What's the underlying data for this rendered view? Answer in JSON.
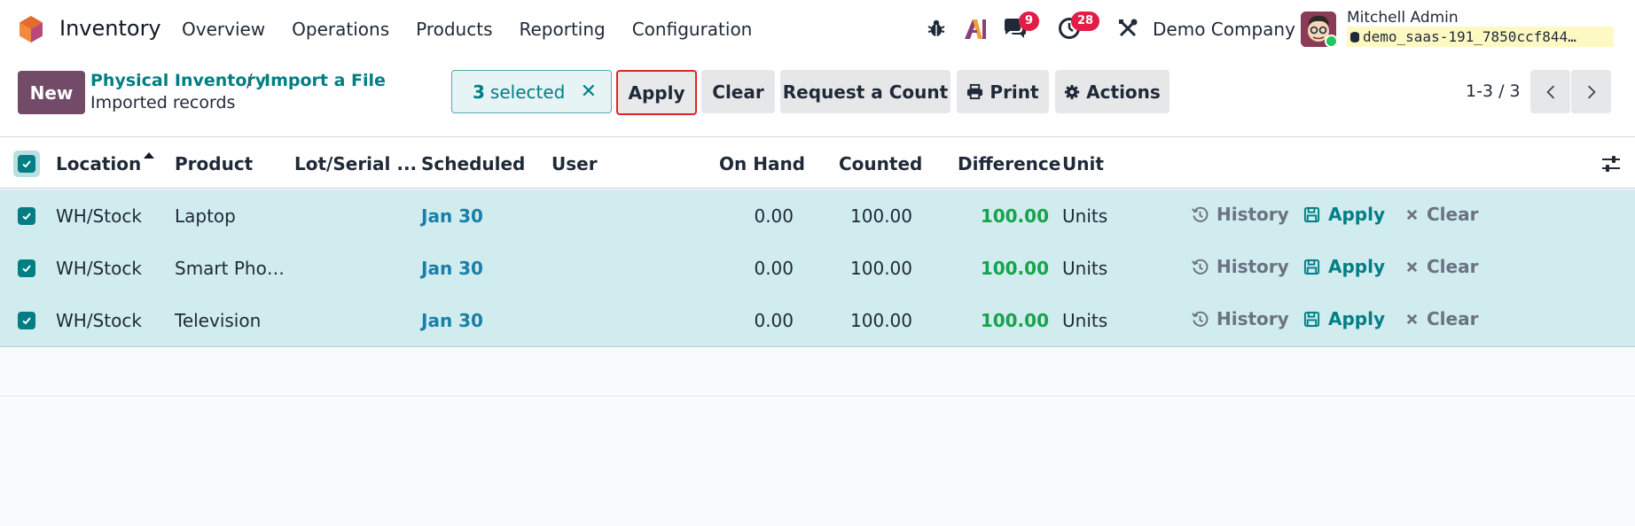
{
  "navbar": {
    "app_name": "Inventory",
    "menu": [
      "Overview",
      "Operations",
      "Products",
      "Reporting",
      "Configuration"
    ],
    "messages_badge": "9",
    "activities_badge": "28",
    "company": "Demo Company",
    "user_name": "Mitchell Admin",
    "database": "demo_saas-191_7850ccf844…"
  },
  "control_panel": {
    "new_label": "New",
    "breadcrumbs": [
      "Physical Inventory",
      "Import a File"
    ],
    "breadcrumb_separator": "/",
    "subtitle": "Imported records",
    "selected_count": "3",
    "selected_label": "selected",
    "apply_label": "Apply",
    "clear_label": "Clear",
    "request_count_label": "Request a Count",
    "print_label": "Print",
    "actions_label": "Actions",
    "pager": "1-3 / 3"
  },
  "table": {
    "columns": [
      "Location",
      "Product",
      "Lot/Serial ...",
      "Scheduled",
      "User",
      "On Hand",
      "Counted",
      "Difference",
      "Unit"
    ],
    "rows": [
      {
        "location": "WH/Stock",
        "product": "Laptop",
        "lot": "",
        "scheduled": "Jan 30",
        "user": "",
        "on_hand": "0.00",
        "counted": "100.00",
        "difference": "100.00",
        "unit": "Units"
      },
      {
        "location": "WH/Stock",
        "product": "Smart Pho…",
        "lot": "",
        "scheduled": "Jan 30",
        "user": "",
        "on_hand": "0.00",
        "counted": "100.00",
        "difference": "100.00",
        "unit": "Units"
      },
      {
        "location": "WH/Stock",
        "product": "Television",
        "lot": "",
        "scheduled": "Jan 30",
        "user": "",
        "on_hand": "0.00",
        "counted": "100.00",
        "difference": "100.00",
        "unit": "Units"
      }
    ],
    "row_actions": {
      "history": "History",
      "apply": "Apply",
      "clear": "Clear"
    }
  },
  "colors": {
    "brand": "#714b67",
    "accent": "#017e84",
    "selected_row": "#d0ecef",
    "positive": "#16a34a",
    "badge": "#e11d48"
  },
  "icons": [
    "odoo-logo-icon",
    "bug-icon",
    "ai-icon",
    "chat-icon",
    "clock-icon",
    "tools-icon",
    "database-icon",
    "close-icon",
    "print-icon",
    "gear-icon",
    "chevron-left-icon",
    "chevron-right-icon",
    "sort-up-icon",
    "history-icon",
    "save-icon",
    "settings-sliders-icon",
    "checkbox-icon"
  ]
}
